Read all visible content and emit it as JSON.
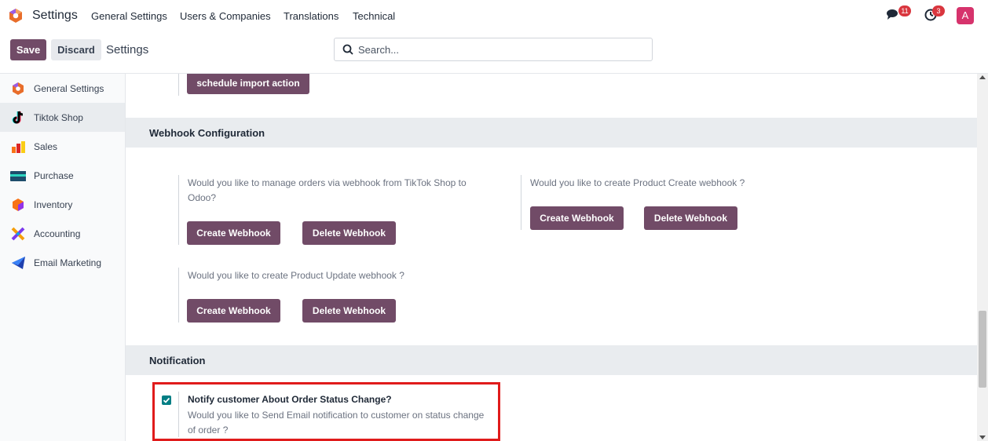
{
  "topnav": {
    "app_name": "Settings",
    "menu": [
      "General Settings",
      "Users & Companies",
      "Translations",
      "Technical"
    ],
    "chat_badge": "11",
    "activity_badge": "3",
    "avatar_letter": "A"
  },
  "control": {
    "save_label": "Save",
    "discard_label": "Discard",
    "breadcrumb": "Settings",
    "search_placeholder": "Search..."
  },
  "sidebar": {
    "items": [
      {
        "label": "General Settings",
        "icon": "odoo-logo-icon"
      },
      {
        "label": "Tiktok Shop",
        "icon": "tiktok-icon"
      },
      {
        "label": "Sales",
        "icon": "sales-chart-icon"
      },
      {
        "label": "Purchase",
        "icon": "purchase-card-icon"
      },
      {
        "label": "Inventory",
        "icon": "inventory-box-icon"
      },
      {
        "label": "Accounting",
        "icon": "accounting-icon"
      },
      {
        "label": "Email Marketing",
        "icon": "email-marketing-icon"
      }
    ]
  },
  "main": {
    "schedule_import_label": "schedule import action",
    "webhook_section": "Webhook Configuration",
    "webhooks": [
      {
        "question": "Would you like to manage orders via webhook from TikTok Shop to Odoo?",
        "create_label": "Create Webhook",
        "delete_label": "Delete Webhook"
      },
      {
        "question": "Would you like to create Product Create webhook ?",
        "create_label": "Create Webhook",
        "delete_label": "Delete Webhook"
      },
      {
        "question": "Would you like to create Product Update webhook ?",
        "create_label": "Create Webhook",
        "delete_label": "Delete Webhook"
      }
    ],
    "notification_section": "Notification",
    "notify": {
      "checked": true,
      "title": "Notify customer About Order Status Change?",
      "description": "Would you like to Send Email notification to customer on status change of order ?"
    }
  },
  "colors": {
    "primary": "#714b67",
    "checkbox": "#017e84",
    "badge": "#d9363e",
    "avatar": "#d6336c",
    "highlight": "#e01b1b"
  }
}
